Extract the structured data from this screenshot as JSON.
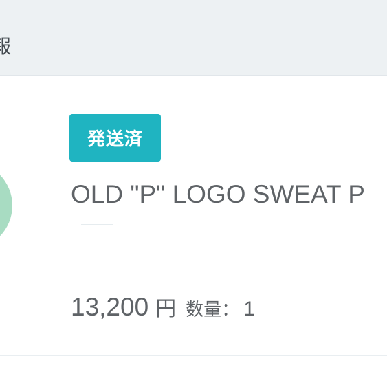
{
  "section": {
    "title": "報"
  },
  "order_item": {
    "status": "発送済",
    "product_name": "OLD \"P\" LOGO SWEAT P",
    "price": "13,200",
    "currency": "円",
    "quantity_label": "数量：",
    "quantity": "1"
  },
  "colors": {
    "header_background": "#edf1f3",
    "status_badge": "#1fb4c1",
    "text": "#5f6367",
    "thumbnail": "#a8dcc2"
  }
}
